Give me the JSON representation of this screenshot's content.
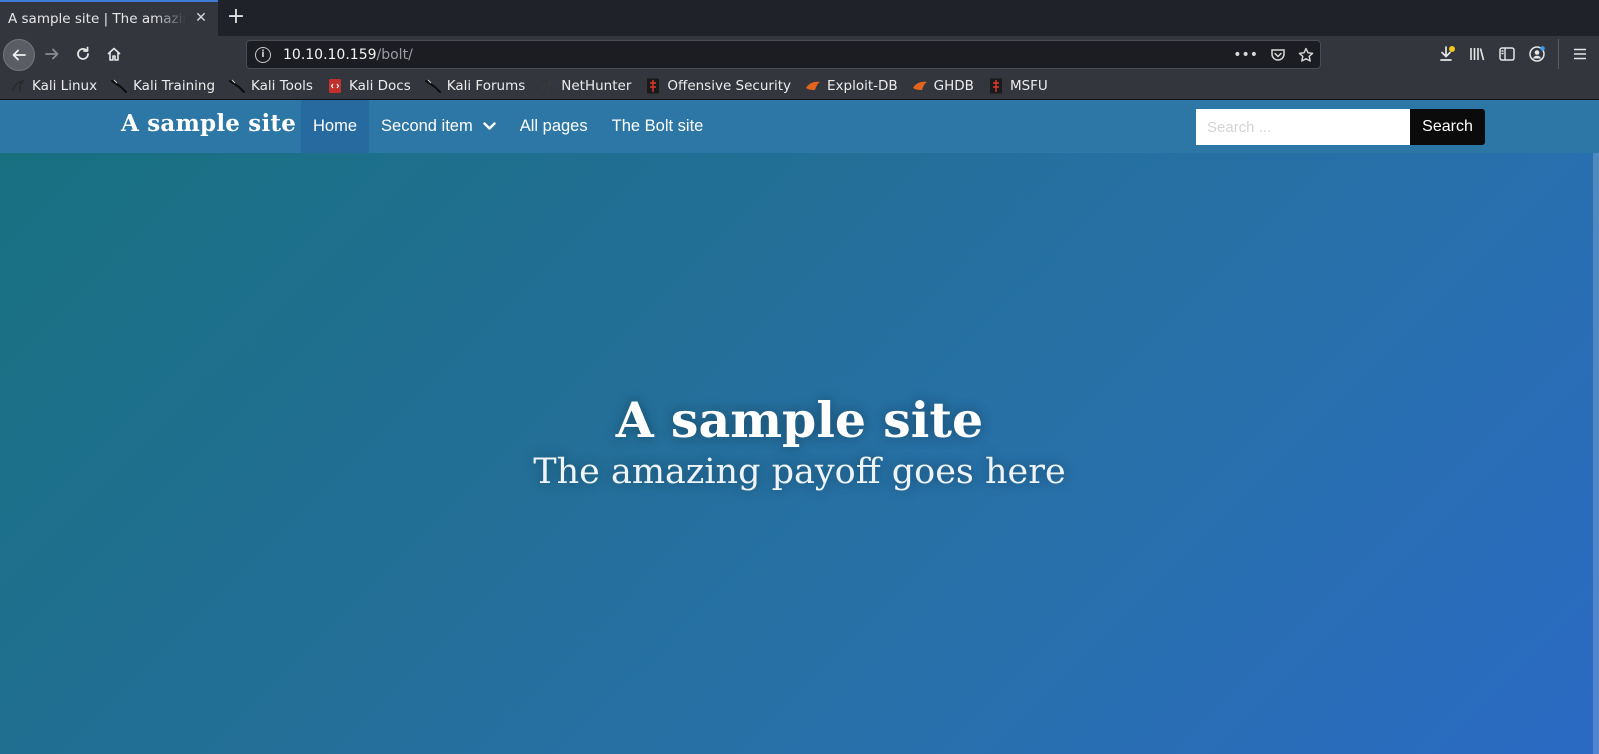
{
  "browser": {
    "tab": {
      "title": "A sample site | The amazing payoff goes here",
      "close_icon": "close-icon"
    },
    "new_tab_label": "+",
    "url": {
      "host": "10.10.10.159",
      "path": "/bolt/"
    },
    "url_actions_label": "•••",
    "bookmarks": [
      {
        "label": "Kali Linux",
        "icon": "kali-icon"
      },
      {
        "label": "Kali Training",
        "icon": "kali-dragon-icon"
      },
      {
        "label": "Kali Tools",
        "icon": "kali-dragon-icon"
      },
      {
        "label": "Kali Docs",
        "icon": "docs-icon"
      },
      {
        "label": "Kali Forums",
        "icon": "kali-dragon-icon"
      },
      {
        "label": "NetHunter",
        "icon": "nethunter-icon"
      },
      {
        "label": "Offensive Security",
        "icon": "offsec-icon"
      },
      {
        "label": "Exploit-DB",
        "icon": "exploit-db-icon"
      },
      {
        "label": "GHDB",
        "icon": "ghdb-icon"
      },
      {
        "label": "MSFU",
        "icon": "msfu-icon"
      }
    ]
  },
  "site": {
    "brand": "A sample site",
    "menu": [
      {
        "label": "Home",
        "active": true
      },
      {
        "label": "Second item",
        "dropdown": true
      },
      {
        "label": "All pages"
      },
      {
        "label": "The Bolt site"
      }
    ],
    "search": {
      "placeholder": "Search ...",
      "button": "Search"
    },
    "hero": {
      "title": "A sample site",
      "subtitle": "The amazing payoff goes here"
    }
  },
  "colors": {
    "nav_bg": "#2d77a6",
    "active_item": "#266aa0",
    "hero_gradient_start": "#18707f",
    "hero_gradient_end": "#2a6ac4",
    "search_button": "#0b0b0b"
  }
}
